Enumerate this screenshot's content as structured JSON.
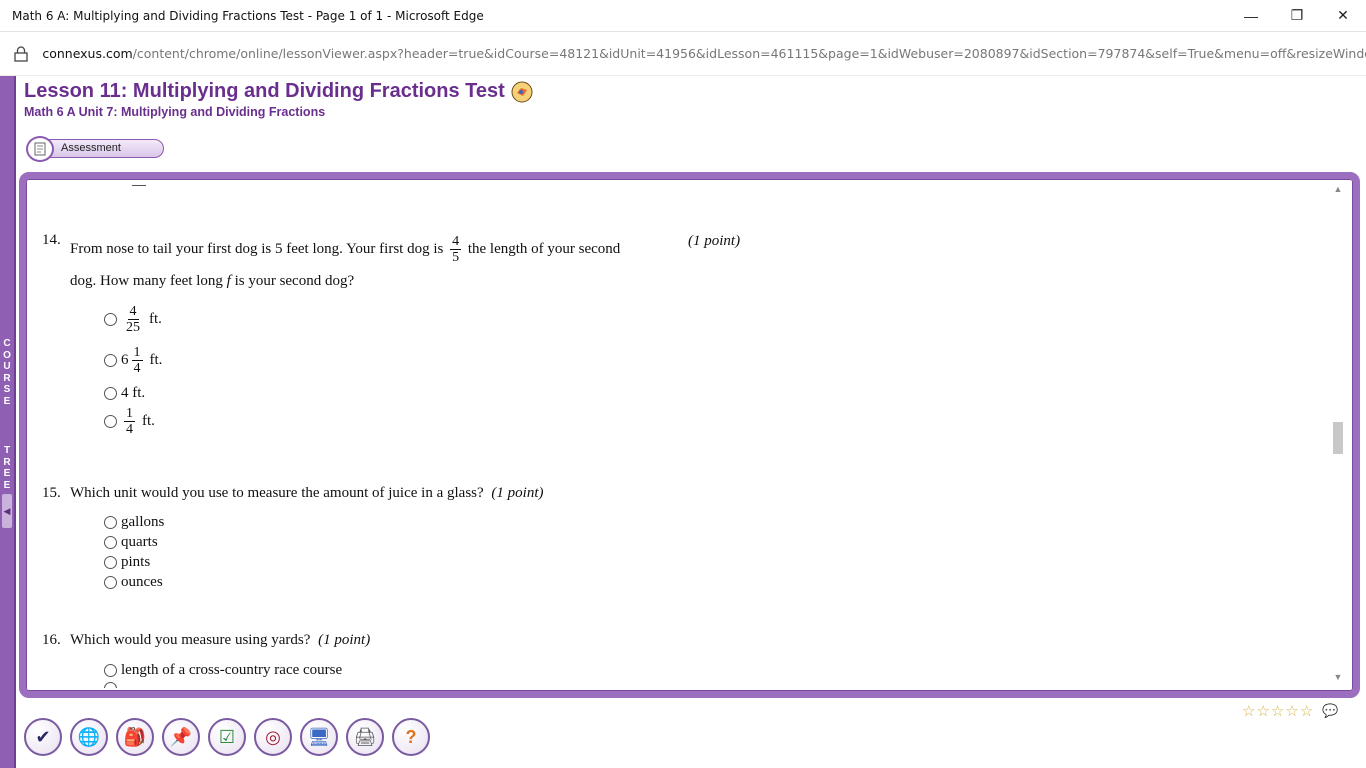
{
  "window": {
    "title": "Math 6 A: Multiplying and Dividing Fractions Test - Page 1 of 1 - Microsoft Edge",
    "minimize": "—",
    "maximize": "❐",
    "close": "✕"
  },
  "address": {
    "domain": "connexus.com",
    "path": "/content/chrome/online/lessonViewer.aspx?header=true&idCourse=48121&idUnit=41956&idLesson=461115&page=1&idWebuser=2080897&idSection=797874&self=True&menu=off&resizeWindow=true"
  },
  "course_tree": {
    "letters": [
      "C",
      "O",
      "U",
      "R",
      "S",
      "E",
      " ",
      "T",
      "R",
      "E",
      "E"
    ],
    "toggle": "◀"
  },
  "lesson": {
    "title": "Lesson 11: Multiplying and Dividing Fractions Test",
    "subtitle": "Math 6 A  Unit 7: Multiplying and Dividing Fractions",
    "tab": "Assessment"
  },
  "questions": {
    "q14": {
      "num": "14.",
      "text_a": "From nose to tail your first dog is 5 feet long. Your first dog is",
      "frac_num": "4",
      "frac_den": "5",
      "text_b": "the length of your second",
      "text_c": "dog. How many feet long",
      "var": "f",
      "text_d": "is your second dog?",
      "points": "(1 point)",
      "options": {
        "a": {
          "num": "4",
          "den": "25",
          "unit": "ft."
        },
        "b": {
          "whole": "6",
          "num": "1",
          "den": "4",
          "unit": "ft."
        },
        "c": {
          "text": "4 ft."
        },
        "d": {
          "num": "1",
          "den": "4",
          "unit": "ft."
        }
      }
    },
    "q15": {
      "num": "15.",
      "text": "Which unit would you use to measure the amount of juice in a glass?",
      "points": "(1 point)",
      "options": [
        "gallons",
        "quarts",
        "pints",
        "ounces"
      ]
    },
    "q16": {
      "num": "16.",
      "text": "Which would you measure using yards?",
      "points": "(1 point)",
      "options": [
        "length of a cross-country race course"
      ]
    }
  },
  "toolbar": {
    "icons": [
      "check-icon",
      "globe-icon",
      "backpack-icon",
      "pin-icon",
      "checklist-icon",
      "target-icon",
      "monitor-icon",
      "printer-icon",
      "help-icon"
    ],
    "glyphs": [
      "✔",
      "🌐",
      "🎒",
      "📌",
      "☑",
      "◎",
      "🖥",
      "🖨",
      "?"
    ]
  },
  "rating": {
    "stars": [
      "☆",
      "☆",
      "☆",
      "☆",
      "☆"
    ],
    "comment": "💬"
  }
}
